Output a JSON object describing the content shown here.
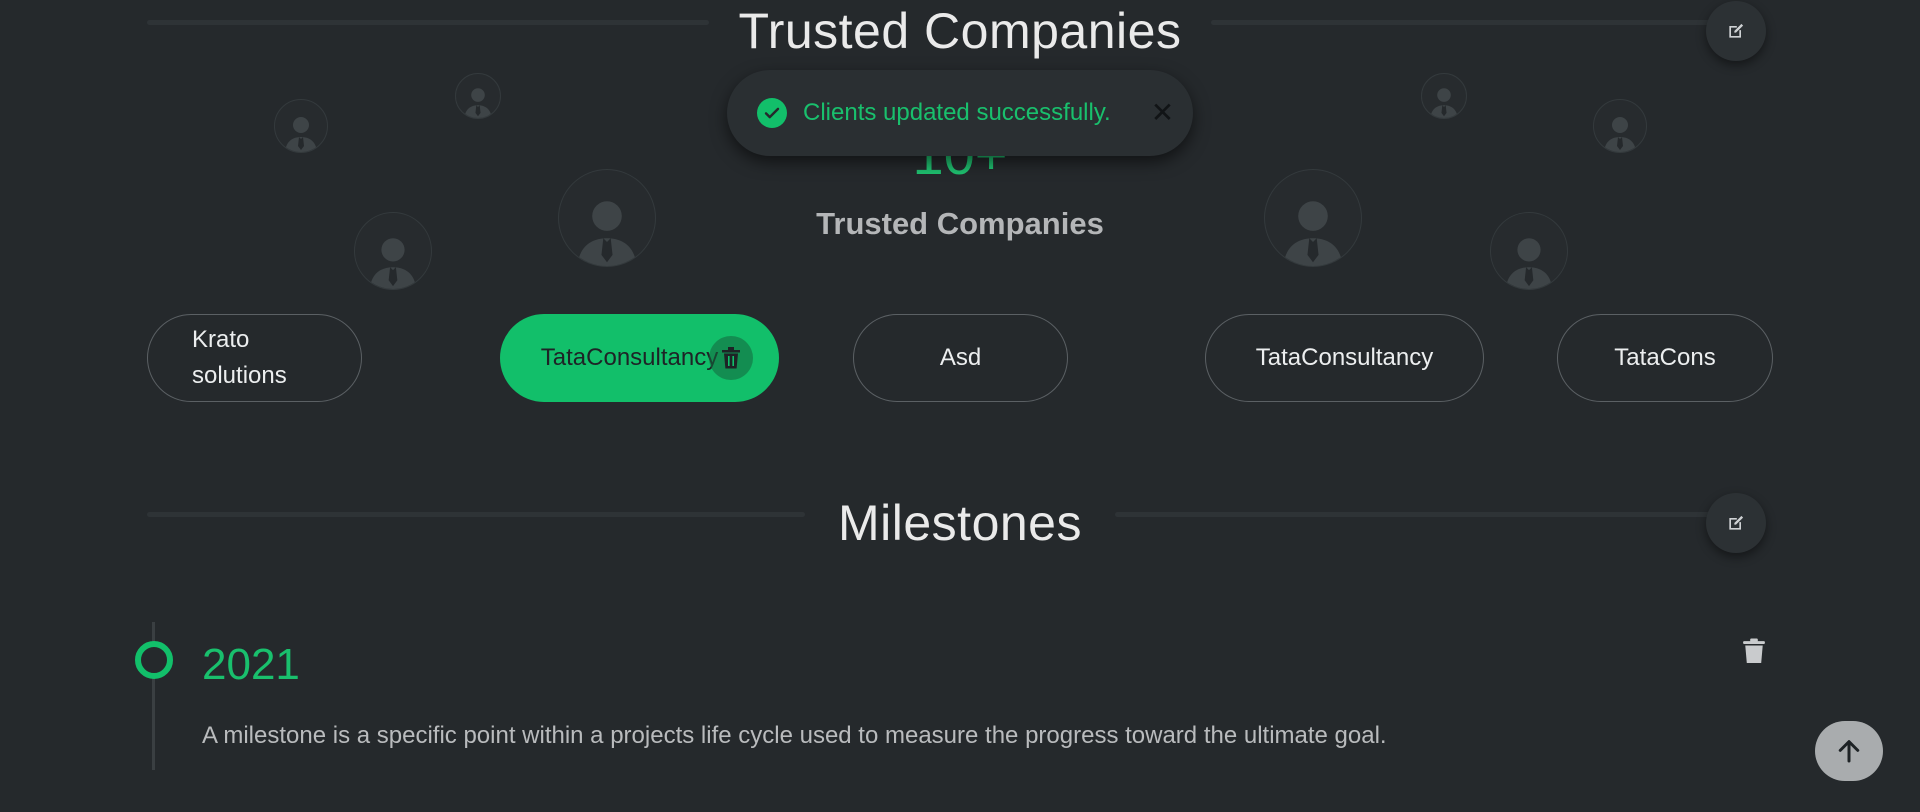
{
  "trusted": {
    "title": "Trusted Companies",
    "counter": "10+",
    "counter_label": "Trusted Companies",
    "clients": [
      {
        "name": "Krato\nsolutions"
      },
      {
        "name": "TataConsultancy"
      },
      {
        "name": "Asd"
      },
      {
        "name": "TataConsultancy"
      },
      {
        "name": "TataCons"
      }
    ]
  },
  "toast": {
    "message": "Clients updated successfully.",
    "close": "✕"
  },
  "milestones": {
    "title": "Milestones",
    "items": [
      {
        "year": "2021",
        "description": "A milestone is a specific point within a projects life cycle used to measure the progress toward the ultimate goal."
      }
    ]
  },
  "icons": {
    "edit": "edit-icon",
    "trash": "trash-icon",
    "check": "check-icon",
    "arrow_up": "arrow-up-icon",
    "avatar": "user-avatar-icon"
  },
  "colors": {
    "background": "#25292c",
    "accent": "#12bf6a"
  }
}
